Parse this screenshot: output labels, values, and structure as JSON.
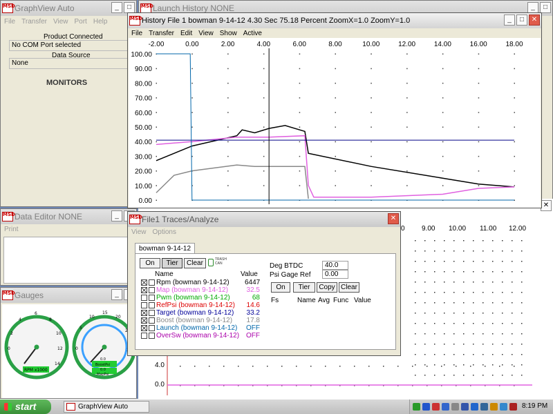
{
  "graphview": {
    "title": "GraphView Auto",
    "menu": [
      "File",
      "Transfer",
      "View",
      "Port",
      "Help"
    ],
    "product_label": "Product Connected",
    "product_value": "No COM Port selected",
    "source_label": "Data Source",
    "source_value": "None",
    "monitors": "MONITORS"
  },
  "launch_history": {
    "title": "Launch History   NONE"
  },
  "history": {
    "title": "History File 1    bowman 9-14-12    4.30 Sec   75.18 Percent   ZoomX=1.0   ZoomY=1.0",
    "menu": [
      "File",
      "Transfer",
      "Edit",
      "View",
      "Show",
      "Active"
    ]
  },
  "chart_data": {
    "type": "line",
    "xlim": [
      -2,
      18
    ],
    "ylim": [
      0,
      100
    ],
    "x_ticks": [
      "-2.00",
      "0.00",
      "2.00",
      "4.00",
      "6.00",
      "8.00",
      "10.00",
      "12.00",
      "14.00",
      "16.00",
      "18.00"
    ],
    "y_ticks": [
      "100.00",
      "90.00",
      "80.00",
      "70.00",
      "60.00",
      "50.00",
      "40.00",
      "30.00",
      "20.00",
      "10.00",
      "0.00"
    ],
    "cursor_x": 4.3,
    "series": [
      {
        "color": "#000000",
        "x": [
          -2,
          0,
          2.5,
          2.8,
          3.5,
          4.3,
          5.2,
          6.3,
          6.5,
          10,
          14,
          16,
          18
        ],
        "y": [
          27,
          37,
          44,
          48,
          46,
          49,
          51,
          47,
          32,
          23,
          15,
          11,
          9
        ]
      },
      {
        "color": "#e060e0",
        "x": [
          -2,
          0,
          2.5,
          3.5,
          4.3,
          6.3,
          6.5,
          6.8,
          10,
          14,
          16,
          18
        ],
        "y": [
          38,
          40,
          43,
          43,
          43,
          44,
          10,
          2,
          2,
          4,
          8,
          9
        ]
      },
      {
        "color": "#888888",
        "x": [
          -2,
          -1,
          0,
          2.5,
          3.5,
          4.3,
          6.3,
          6.5
        ],
        "y": [
          5,
          17,
          20,
          24,
          23,
          23,
          23,
          1
        ]
      },
      {
        "color": "#000088",
        "x": [
          -2,
          18
        ],
        "y": [
          41,
          41
        ]
      },
      {
        "color": "#0066aa",
        "x": [
          -2,
          -0.1,
          0,
          18
        ],
        "y": [
          100,
          100,
          0,
          0
        ]
      }
    ]
  },
  "data_editor": {
    "title": "Data Editor   NONE",
    "menu": [
      "Print"
    ]
  },
  "gauges": {
    "title": "Gauges",
    "g1_ticks": [
      "0",
      "2",
      "4",
      "6",
      "8",
      "10",
      "12",
      "14"
    ],
    "g1_label": "RPM x1000",
    "g2_ticks": [
      "0",
      "5",
      "10",
      "15",
      "20",
      "25",
      "30"
    ],
    "g2_readouts": [
      "0.0",
      "BoostPsi",
      "0.0",
      "MapPsi"
    ]
  },
  "traces": {
    "title": "File1 Traces/Analyze",
    "menu": [
      "View",
      "Options"
    ],
    "tab": "bowman 9-14-12",
    "buttons": [
      "On",
      "Tier",
      "Clear"
    ],
    "trash": "TRASH CAN",
    "col_name": "Name",
    "col_value": "Value",
    "rows": [
      {
        "name": "Rpm (bowman 9-14-12)",
        "value": "6447",
        "color": "#000000",
        "checked": true
      },
      {
        "name": "Map (bowman 9-14-12)",
        "value": "32.5",
        "color": "#e060e0",
        "checked": true
      },
      {
        "name": "Pwm (bowman 9-14-12)",
        "value": "68",
        "color": "#00aa00",
        "checked": false
      },
      {
        "name": "RefPsi (bowman 9-14-12)",
        "value": "14.6",
        "color": "#dd0000",
        "checked": false
      },
      {
        "name": "Target (bowman 9-14-12)",
        "value": "33.2",
        "color": "#000099",
        "checked": true
      },
      {
        "name": "Boost (bowman 9-14-12)",
        "value": "17.8",
        "color": "#888888",
        "checked": true
      },
      {
        "name": "Launch (bowman 9-14-12)",
        "value": "OFF",
        "color": "#0066aa",
        "checked": true
      },
      {
        "name": "OverSw (bowman 9-14-12)",
        "value": "OFF",
        "color": "#aa00aa",
        "checked": false
      }
    ],
    "deg_label": "Deg BTDC",
    "deg_value": "40.0",
    "psi_label": "Psi Gage Ref",
    "psi_value": "0.00",
    "buttons2": [
      "On",
      "Tier",
      "Copy",
      "Clear"
    ],
    "fs_cols": [
      "Fs",
      "Name",
      "Avg",
      "Func",
      "Value"
    ]
  },
  "lower_plot": {
    "x_ticks": [
      "0",
      "9.00",
      "10.00",
      "11.00",
      "12.00"
    ],
    "y_ticks": [
      "4.0",
      "0.0"
    ]
  },
  "taskbar": {
    "start": "start",
    "task": "GraphView Auto",
    "clock": "8:19 PM"
  }
}
